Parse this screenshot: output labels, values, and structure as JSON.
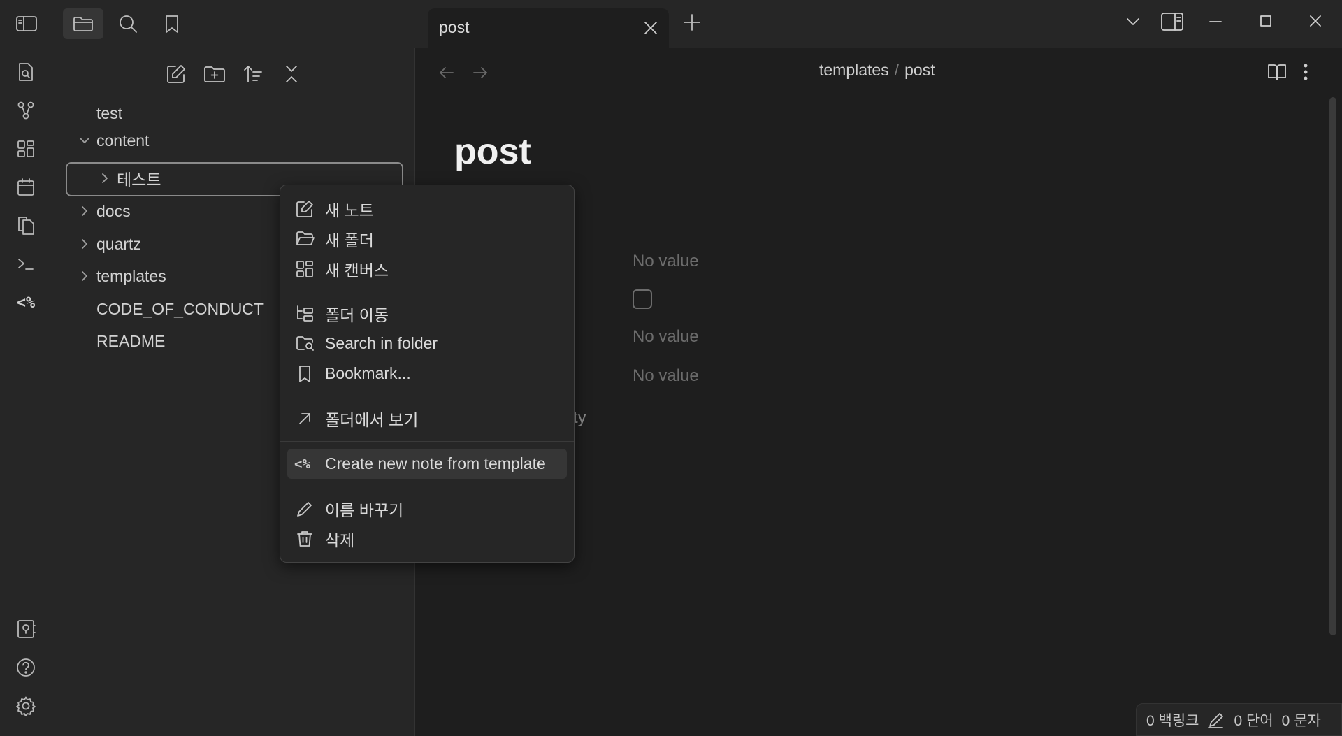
{
  "tab": {
    "title": "post"
  },
  "sidebar": {
    "tree": [
      {
        "label": "test",
        "type": "file"
      },
      {
        "label": "content",
        "type": "folder",
        "expanded": true
      },
      {
        "label": "테스트",
        "type": "folder",
        "expanded": false
      },
      {
        "label": "docs",
        "type": "folder",
        "expanded": false
      },
      {
        "label": "quartz",
        "type": "folder",
        "expanded": false
      },
      {
        "label": "templates",
        "type": "folder",
        "expanded": false
      },
      {
        "label": "CODE_OF_CONDUCT",
        "type": "file"
      },
      {
        "label": "README",
        "type": "file"
      }
    ]
  },
  "ribbon": {
    "templater_glyph": "<%"
  },
  "main": {
    "breadcrumb": {
      "folder": "templates",
      "separator": "/",
      "file": "post"
    },
    "doc_title": "post",
    "properties": {
      "value_1": "No value",
      "value_3": "No value",
      "value_4": "No value",
      "partial_label": "ty"
    }
  },
  "context_menu": {
    "items": [
      {
        "label": "새 노트",
        "icon": "edit-icon"
      },
      {
        "label": "새 폴더",
        "icon": "folder-open-icon"
      },
      {
        "label": "새 캔버스",
        "icon": "canvas-icon"
      },
      {
        "label": "폴더 이동",
        "icon": "folder-tree-icon"
      },
      {
        "label": "Search in folder",
        "icon": "folder-search-icon"
      },
      {
        "label": "Bookmark...",
        "icon": "bookmark-icon"
      },
      {
        "label": "폴더에서 보기",
        "icon": "arrow-up-right-icon"
      },
      {
        "label": "Create new note from template",
        "icon_text": "<%"
      },
      {
        "label": "이름 바꾸기",
        "icon": "pencil-icon"
      },
      {
        "label": "삭제",
        "icon": "trash-icon"
      }
    ]
  },
  "statusbar": {
    "backlinks": "0 백링크",
    "words": "0 단어",
    "chars": "0 문자"
  },
  "colors": {
    "background": "#1e1e1e",
    "panel": "#262626",
    "accent_border": "#8a8a8a"
  }
}
